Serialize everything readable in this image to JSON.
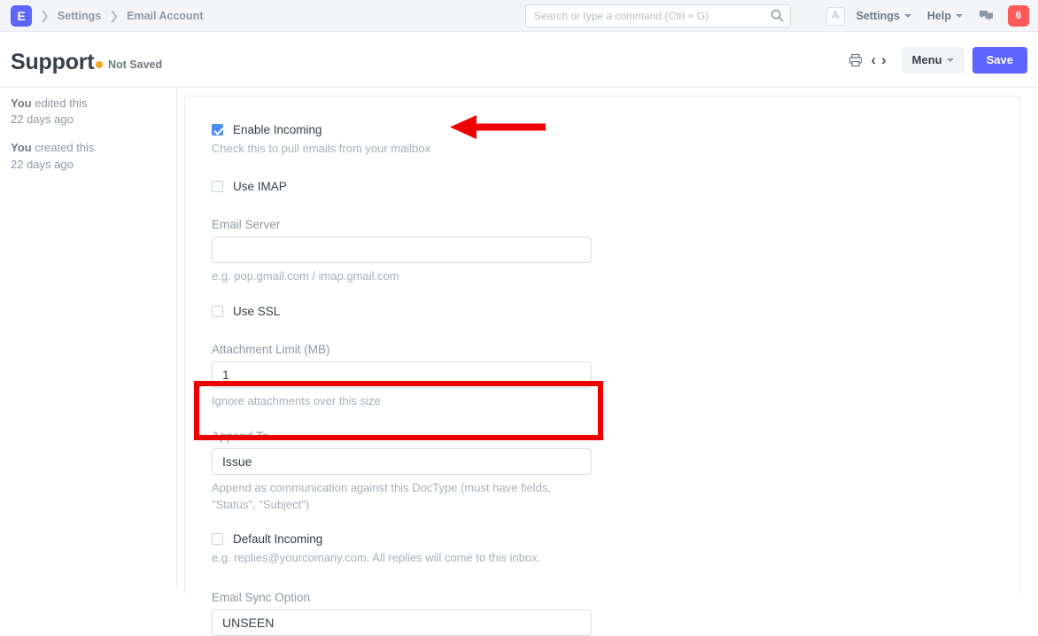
{
  "navbar": {
    "logo_letter": "E",
    "breadcrumbs": [
      {
        "label": "Settings"
      },
      {
        "label": "Email Account"
      }
    ],
    "search": {
      "placeholder": "Search or type a command (Ctrl + G)",
      "value": ""
    },
    "avatar_letter": "A",
    "menus": [
      {
        "label": "Settings"
      },
      {
        "label": "Help"
      }
    ],
    "notification_count": "6"
  },
  "page_header": {
    "title": "Support",
    "status": "Not Saved",
    "status_color": "#f5a623",
    "menu_label": "Menu",
    "save_label": "Save"
  },
  "sidebar": {
    "timeline": [
      {
        "actor": "You",
        "action": "edited this",
        "time": "22 days ago"
      },
      {
        "actor": "You",
        "action": "created this",
        "time": "22 days ago"
      }
    ]
  },
  "form": {
    "enable_incoming": {
      "label": "Enable Incoming",
      "checked": true,
      "help": "Check this to pull emails from your mailbox"
    },
    "use_imap": {
      "label": "Use IMAP",
      "checked": false
    },
    "email_server": {
      "label": "Email Server",
      "value": "",
      "help": "e.g. pop.gmail.com / imap.gmail.com"
    },
    "use_ssl": {
      "label": "Use SSL",
      "checked": false
    },
    "attachment_limit": {
      "label": "Attachment Limit (MB)",
      "value": "1",
      "help": "Ignore attachments over this size"
    },
    "append_to": {
      "label": "Append To",
      "value": "Issue",
      "help": "Append as communication against this DocType (must have fields, \"Status\", \"Subject\")"
    },
    "default_incoming": {
      "label": "Default Incoming",
      "checked": false,
      "help": "e.g. replies@yourcomany.com. All replies will come to this inbox."
    },
    "email_sync_option": {
      "label": "Email Sync Option",
      "value": "UNSEEN"
    }
  },
  "annotations": {
    "arrow_color": "#ef0000",
    "highlight_color": "#ef0000"
  }
}
